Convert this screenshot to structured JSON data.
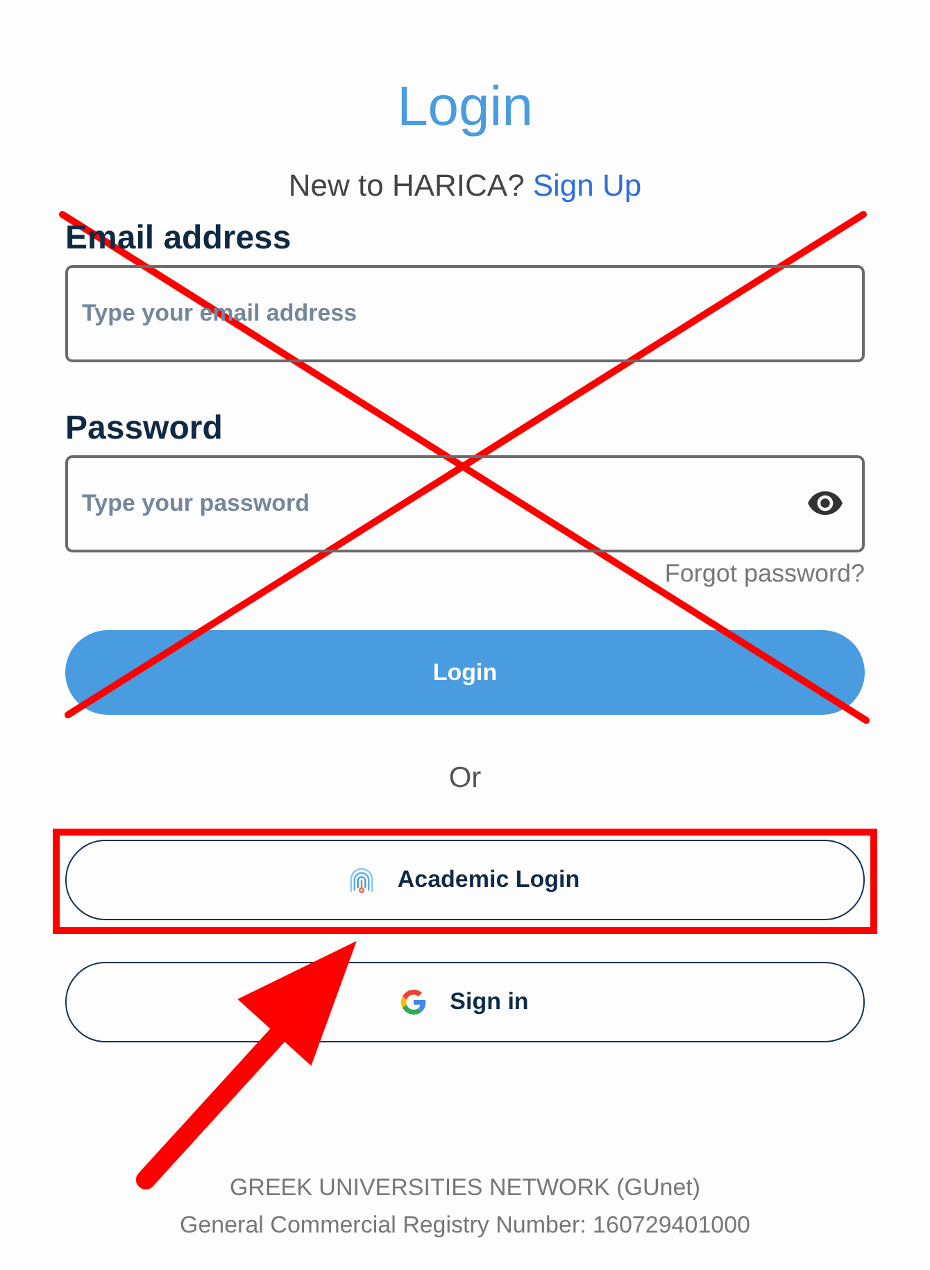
{
  "title": "Login",
  "signup_prompt": {
    "text": "New to HARICA?",
    "link": "Sign Up"
  },
  "login_form": {
    "crossed_out": true,
    "fields": [
      {
        "kind": "email",
        "label": "Email address",
        "placeholder": "Type your email address"
      },
      {
        "kind": "password",
        "label": "Password",
        "placeholder": "Type your password"
      }
    ],
    "forgot_link": "Forgot password?",
    "submit": "Login"
  },
  "separator": "Or",
  "alternative_logins": [
    {
      "kind": "academic",
      "label": "Academic Login",
      "highlighted": true
    },
    {
      "kind": "google",
      "label": "Sign in",
      "highlighted": false
    }
  ],
  "pointer_arrow": true,
  "footer": [
    "GREEK UNIVERSITIES NETWORK (GUnet)",
    "General Commercial Registry Number: 160729401000"
  ]
}
